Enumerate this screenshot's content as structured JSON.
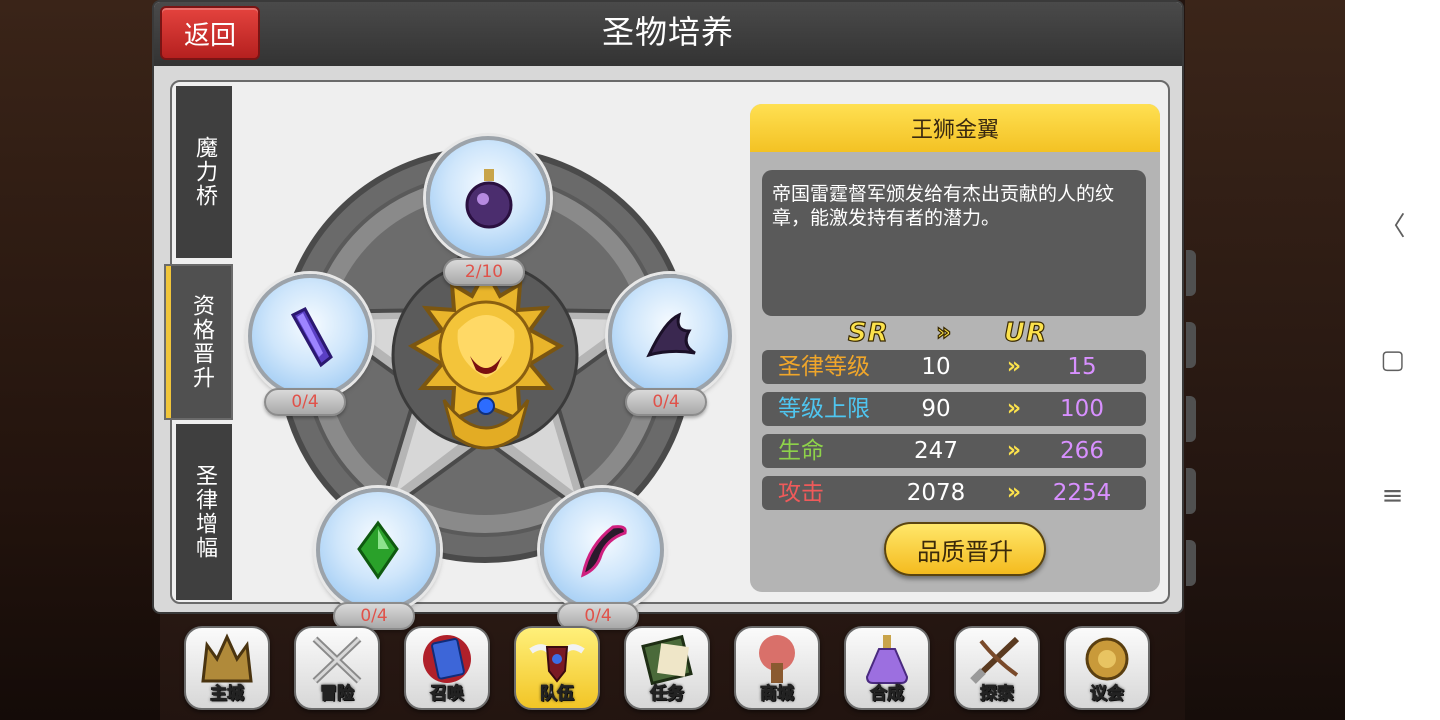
{
  "header": {
    "title": "圣物培养",
    "back_label": "返回"
  },
  "side_tabs": [
    {
      "label": "魔力桥",
      "active": false
    },
    {
      "label": "资格晋升",
      "active": true
    },
    {
      "label": "圣律增幅",
      "active": false
    }
  ],
  "materials": [
    {
      "slot": "top",
      "icon": "potion-bottle-icon",
      "count": "2/10"
    },
    {
      "slot": "left",
      "icon": "purple-crystal-icon",
      "count": "0/4"
    },
    {
      "slot": "right",
      "icon": "dark-claw-icon",
      "count": "0/4"
    },
    {
      "slot": "bottom-left",
      "icon": "green-gem-icon",
      "count": "0/4"
    },
    {
      "slot": "bottom-right",
      "icon": "dark-fang-icon",
      "count": "0/4"
    }
  ],
  "center_relic": {
    "icon": "golden-lion-emblem-icon"
  },
  "item": {
    "name": "王狮金翼",
    "description": "帝国雷霆督军颁发给有杰出贡献的人的纹章，能激发持有者的潜力。",
    "rank_from": "SR",
    "rank_to": "UR",
    "rank_arrow": "»",
    "stats": [
      {
        "label": "圣律等级",
        "current": "10",
        "next": "15",
        "color": "#f0a62a"
      },
      {
        "label": "等级上限",
        "current": "90",
        "next": "100",
        "color": "#4fc6f0"
      },
      {
        "label": "生命",
        "current": "247",
        "next": "266",
        "color": "#8ed24a"
      },
      {
        "label": "攻击",
        "current": "2078",
        "next": "2254",
        "color": "#ef5a5a"
      }
    ],
    "upgrade_label": "品质晋升"
  },
  "bottom_nav": [
    {
      "label": "主城",
      "icon": "castle-crown-icon",
      "active": false
    },
    {
      "label": "冒险",
      "icon": "crossed-swords-icon",
      "active": false
    },
    {
      "label": "召唤",
      "icon": "summon-card-icon",
      "active": false
    },
    {
      "label": "队伍",
      "icon": "winged-shield-icon",
      "active": true
    },
    {
      "label": "任务",
      "icon": "quest-book-icon",
      "active": false
    },
    {
      "label": "商城",
      "icon": "shop-tree-icon",
      "active": false
    },
    {
      "label": "合成",
      "icon": "alchemy-flask-icon",
      "active": false
    },
    {
      "label": "探索",
      "icon": "crossbow-shovel-icon",
      "active": false
    },
    {
      "label": "议会",
      "icon": "council-emblem-icon",
      "active": false
    }
  ],
  "system_nav": [
    {
      "icon": "back-chevron-icon",
      "glyph": "〈"
    },
    {
      "icon": "home-square-icon",
      "glyph": "▢"
    },
    {
      "icon": "menu-lines-icon",
      "glyph": "≡"
    }
  ]
}
